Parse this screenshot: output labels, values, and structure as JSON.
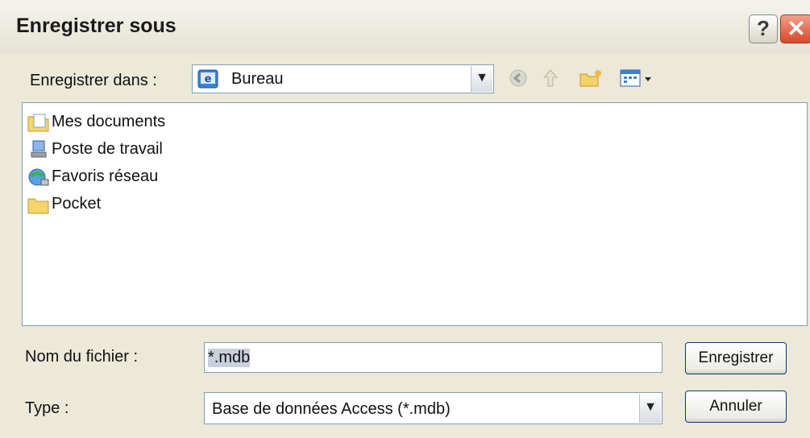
{
  "window": {
    "title": "Enregistrer sous",
    "help_glyph": "?",
    "close_glyph": "✕"
  },
  "save_in": {
    "label": "Enregistrer dans :",
    "value": "Bureau",
    "value_icon": "desktop-icon"
  },
  "toolbar": {
    "icons": [
      "back-icon",
      "up-folder-icon",
      "new-folder-icon",
      "view-menu-icon"
    ]
  },
  "files": [
    {
      "name": "Mes documents",
      "icon": "my-documents-icon"
    },
    {
      "name": "Poste de travail",
      "icon": "my-computer-icon"
    },
    {
      "name": "Favoris réseau",
      "icon": "network-places-icon"
    },
    {
      "name": "Pocket",
      "icon": "folder-icon"
    }
  ],
  "filename": {
    "label": "Nom du fichier :",
    "value": "*.mdb"
  },
  "filetype": {
    "label": "Type :",
    "value": "Base de données Access (*.mdb)"
  },
  "buttons": {
    "save": "Enregistrer",
    "cancel": "Annuler"
  },
  "colors": {
    "background": "#ECE9D8",
    "border_blue": "#7f9db9",
    "close_red": "#d8482a"
  }
}
